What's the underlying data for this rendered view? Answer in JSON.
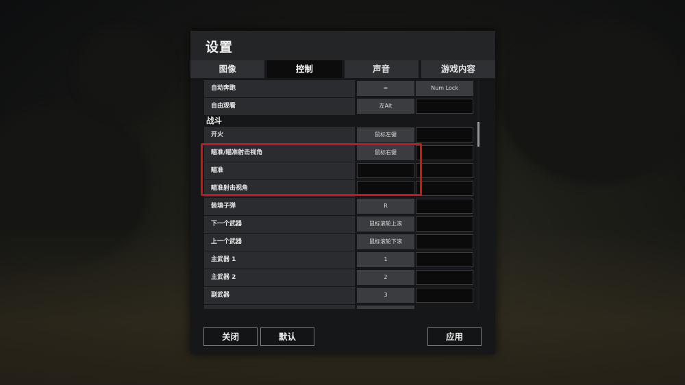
{
  "window": {
    "title": "设置"
  },
  "tabs": [
    {
      "label": "图像",
      "active": false
    },
    {
      "label": "控制",
      "active": true
    },
    {
      "label": "声音",
      "active": false
    },
    {
      "label": "游戏内容",
      "active": false
    }
  ],
  "pre_rows": [
    {
      "label": "自动奔跑",
      "key1": "=",
      "key2": "Num Lock"
    },
    {
      "label": "自由观看",
      "key1": "左Alt",
      "key2": ""
    }
  ],
  "section_combat": "战斗",
  "combat_rows": [
    {
      "label": "开火",
      "key1": "鼠标左键",
      "key2": ""
    },
    {
      "label": "瞄准/瞄准射击视角",
      "key1": "鼠标右键",
      "key2": ""
    },
    {
      "label": "瞄准",
      "key1": "",
      "key2": ""
    },
    {
      "label": "瞄准射击视角",
      "key1": "",
      "key2": ""
    },
    {
      "label": "装填子弹",
      "key1": "R",
      "key2": ""
    },
    {
      "label": "下一个武器",
      "key1": "鼠标滚轮上滚",
      "key2": ""
    },
    {
      "label": "上一个武器",
      "key1": "鼠标滚轮下滚",
      "key2": ""
    },
    {
      "label": "主武器 1",
      "key1": "1",
      "key2": ""
    },
    {
      "label": "主武器 2",
      "key1": "2",
      "key2": ""
    },
    {
      "label": "副武器",
      "key1": "3",
      "key2": ""
    }
  ],
  "buttons": {
    "close": "关闭",
    "default": "默认",
    "apply": "应用"
  },
  "colors": {
    "highlight": "#c8161d",
    "panel": "#161718",
    "active_tab": "#0c0c0d"
  }
}
